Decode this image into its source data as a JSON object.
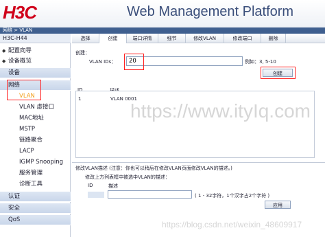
{
  "header": {
    "logo": "H3C",
    "title": "Web Management Platform"
  },
  "breadcrumb": "网络 > VLAN",
  "device": "H3C-H44",
  "sidebar": {
    "top_items": [
      "配置向导",
      "设备概览"
    ],
    "sec_device": "设备",
    "sec_network": "网络",
    "network_items": [
      "VLAN",
      "VLAN 虚接口",
      "MAC地址",
      "MSTP",
      "链路聚合",
      "LACP",
      "IGMP Snooping",
      "服务管理",
      "诊断工具"
    ],
    "sec_auth": "认证",
    "sec_security": "安全",
    "sec_qos": "QoS"
  },
  "tabs": [
    "选择",
    "创建",
    "端口详情",
    "细节",
    "修改VLAN",
    "修改端口",
    "删除"
  ],
  "create": {
    "section_label": "创建：",
    "vlan_ids_label": "VLAN IDs：",
    "vlan_ids_value": "20",
    "example": "例如：3, 5-10",
    "create_button": "创建"
  },
  "list": {
    "col_id": "ID",
    "col_desc": "描述",
    "rows": [
      {
        "id": "1",
        "desc": "VLAN 0001"
      }
    ]
  },
  "modify": {
    "note": "修改VLAN描述 (注意：你也可以稍后在修改VLAN页面修改VLAN的描述。)",
    "instruction": "修改上方列表框中被选中VLAN的描述：",
    "col_id": "ID",
    "col_desc": "描述",
    "desc_value": "",
    "hint": "( 1 - 32字符，1个汉字占2个字符 )",
    "apply_button": "应用"
  },
  "watermarks": [
    "https://www.ityIq.com",
    "https://blog.csdn.net/weixin_48609917"
  ],
  "colors": {
    "brand_red": "#d0021b",
    "nav_dark": "#3f5f8f",
    "active_item": "#f29f1a",
    "highlight": "#ff2020"
  }
}
